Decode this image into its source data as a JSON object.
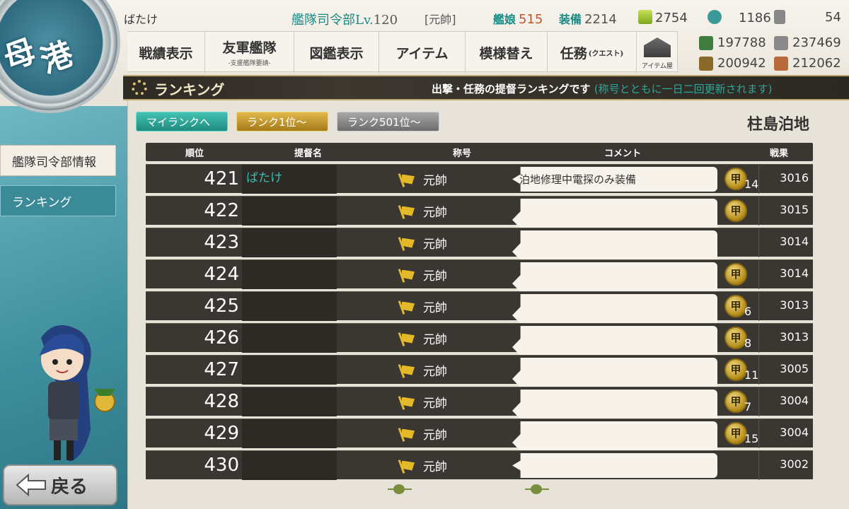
{
  "header": {
    "home_label_1": "母",
    "home_label_2": "港",
    "player_name": "ばたけ",
    "hq_label": "艦隊司令部Lv.",
    "hq_level": "120",
    "rank_title": "[元帥]",
    "ships_label": "艦娘",
    "ships_count": "515",
    "equip_label": "装備",
    "equip_count": "2214",
    "buckets": "2754",
    "dev_materials": "1186",
    "screws": "54"
  },
  "menu": [
    {
      "label": "戦績表示"
    },
    {
      "label": "友軍艦隊",
      "sub": "-支援艦隊要請-"
    },
    {
      "label": "図鑑表示"
    },
    {
      "label": "アイテム"
    },
    {
      "label": "模様替え"
    },
    {
      "label": "任務",
      "sub_inline": "(クエスト)"
    }
  ],
  "shop_label": "アイテム屋",
  "materials": {
    "fuel": "197788",
    "steel": "237469",
    "ammo": "200942",
    "bauxite": "212062"
  },
  "banner": {
    "title": "ランキング",
    "desc": "出撃・任務の提督ランキングです",
    "note": "(称号とともに一日二回更新されます)"
  },
  "sidebar": {
    "hq_info": "艦隊司令部情報",
    "ranking": "ランキング",
    "back": "戻る"
  },
  "tabs": {
    "my_rank": "マイランクへ",
    "rank_1": "ランク1位～",
    "rank_501": "ランク501位～"
  },
  "place": "柱島泊地",
  "table": {
    "headers": [
      "順位",
      "提督名",
      "称号",
      "コメント",
      "戦果"
    ],
    "medal_glyph": "甲",
    "rows": [
      {
        "rank": "421",
        "name": "ばたけ",
        "title": "元帥",
        "comment": "泊地修理中電探のみ装備",
        "medal": true,
        "medal_count": "14",
        "score": "3016"
      },
      {
        "rank": "422",
        "name": "",
        "title": "元帥",
        "comment": "",
        "medal": true,
        "medal_count": "",
        "score": "3015"
      },
      {
        "rank": "423",
        "name": "",
        "title": "元帥",
        "comment": "",
        "medal": false,
        "medal_count": "",
        "score": "3014"
      },
      {
        "rank": "424",
        "name": "",
        "title": "元帥",
        "comment": "",
        "medal": true,
        "medal_count": "",
        "score": "3014"
      },
      {
        "rank": "425",
        "name": "",
        "title": "元帥",
        "comment": "",
        "medal": true,
        "medal_count": "6",
        "score": "3013"
      },
      {
        "rank": "426",
        "name": "",
        "title": "元帥",
        "comment": "",
        "medal": true,
        "medal_count": "8",
        "score": "3013"
      },
      {
        "rank": "427",
        "name": "",
        "title": "元帥",
        "comment": "",
        "medal": true,
        "medal_count": "11",
        "score": "3005"
      },
      {
        "rank": "428",
        "name": "",
        "title": "元帥",
        "comment": "",
        "medal": true,
        "medal_count": "7",
        "score": "3004"
      },
      {
        "rank": "429",
        "name": "",
        "title": "元帥",
        "comment": "",
        "medal": true,
        "medal_count": "15",
        "score": "3004"
      },
      {
        "rank": "430",
        "name": "",
        "title": "元帥",
        "comment": "",
        "medal": false,
        "medal_count": "",
        "score": "3002"
      }
    ]
  }
}
